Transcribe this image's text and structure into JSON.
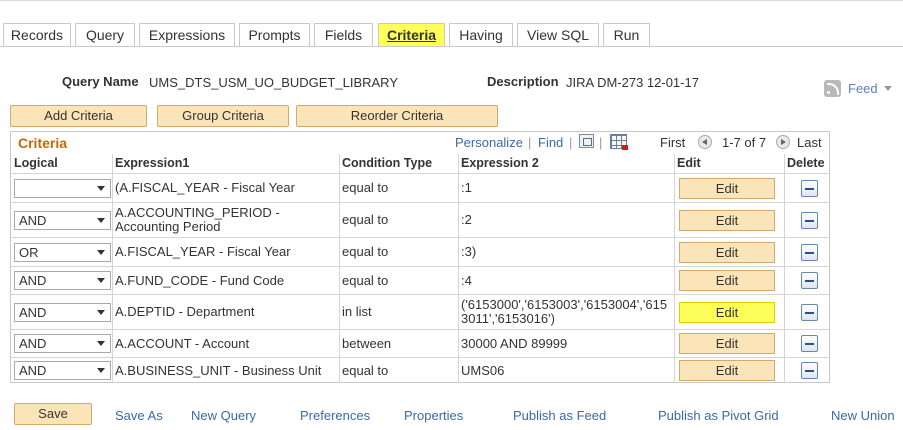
{
  "tabs": [
    {
      "label": "Records"
    },
    {
      "label": "Query"
    },
    {
      "label": "Expressions"
    },
    {
      "label": "Prompts"
    },
    {
      "label": "Fields"
    },
    {
      "label": "Criteria",
      "active": true
    },
    {
      "label": "Having"
    },
    {
      "label": "View SQL"
    },
    {
      "label": "Run"
    }
  ],
  "query": {
    "name_label": "Query Name",
    "name_value": "UMS_DTS_USM_UO_BUDGET_LIBRARY",
    "desc_label": "Description",
    "desc_value": "JIRA DM-273 12-01-17"
  },
  "feed": {
    "label": "Feed",
    "icon": "rss-feed-icon"
  },
  "actions": {
    "add": "Add Criteria",
    "group": "Group Criteria",
    "reorder": "Reorder Criteria"
  },
  "grid": {
    "title": "Criteria",
    "personalize": "Personalize",
    "find": "Find",
    "first": "First",
    "range": "1-7 of 7",
    "last": "Last",
    "headers": {
      "logical": "Logical",
      "expression1": "Expression1",
      "condition": "Condition Type",
      "expression2": "Expression 2",
      "edit": "Edit",
      "delete": "Delete"
    },
    "rows": [
      {
        "logical": "",
        "expr1": "(A.FISCAL_YEAR - Fiscal Year",
        "cond": "equal to",
        "expr2": ":1",
        "edit": "Edit"
      },
      {
        "logical": "AND",
        "expr1": "A.ACCOUNTING_PERIOD - Accounting Period",
        "cond": "equal to",
        "expr2": ":2",
        "edit": "Edit"
      },
      {
        "logical": "OR",
        "expr1": "A.FISCAL_YEAR - Fiscal Year",
        "cond": "equal to",
        "expr2": ":3)",
        "edit": "Edit"
      },
      {
        "logical": "AND",
        "expr1": "A.FUND_CODE - Fund Code",
        "cond": "equal to",
        "expr2": ":4",
        "edit": "Edit"
      },
      {
        "logical": "AND",
        "expr1": "A.DEPTID - Department",
        "cond": "in list",
        "expr2": "('6153000','6153003','6153004','6153011','6153016')",
        "edit": "Edit",
        "highlight": true
      },
      {
        "logical": "AND",
        "expr1": "A.ACCOUNT - Account",
        "cond": "between",
        "expr2": "30000 AND 89999",
        "edit": "Edit"
      },
      {
        "logical": "AND",
        "expr1": "A.BUSINESS_UNIT - Business Unit",
        "cond": "equal to",
        "expr2": "UMS06",
        "edit": "Edit"
      }
    ]
  },
  "footer": {
    "save": "Save",
    "links": [
      "Save As",
      "New Query",
      "Preferences",
      "Properties",
      "Publish as Feed",
      "Publish as Pivot Grid",
      "New Union"
    ]
  },
  "colors": {
    "highlight": "#ffff5c",
    "button": "#fce4b9",
    "link": "#3a6aa8",
    "grid_title": "#c56800"
  }
}
